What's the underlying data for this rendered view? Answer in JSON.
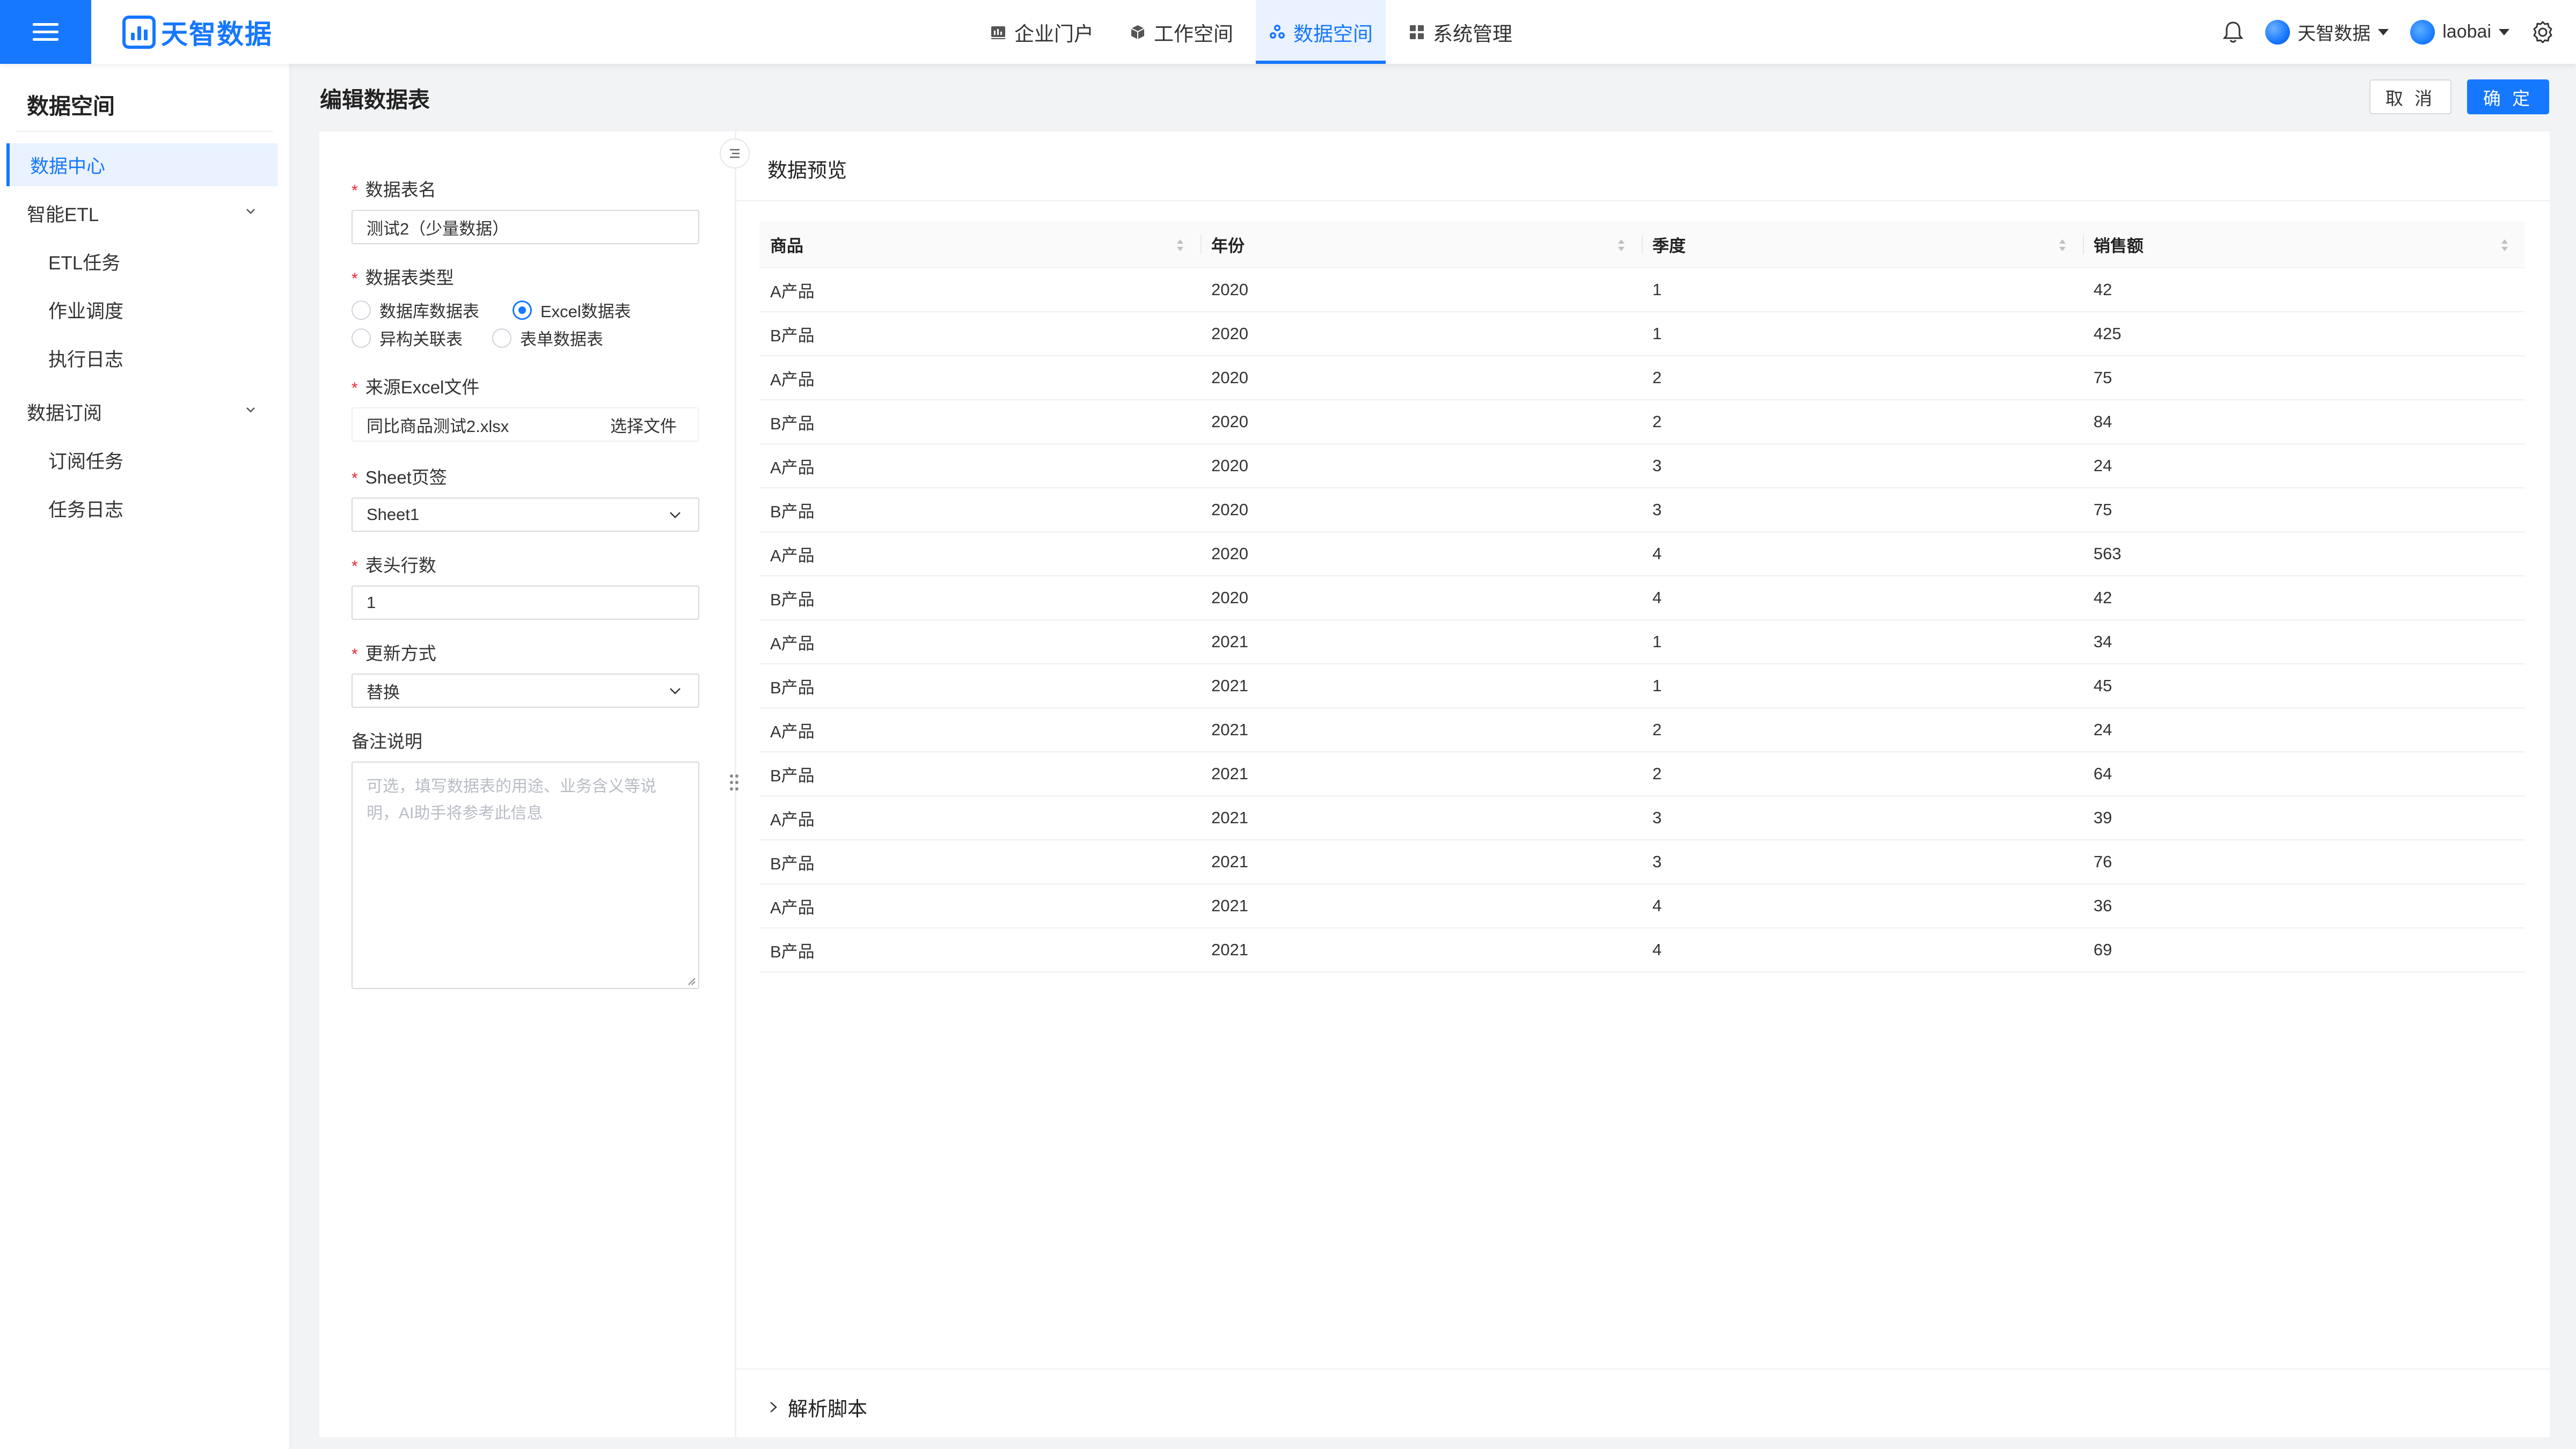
{
  "app": {
    "logo_text": "天智数据",
    "accent_color": "#1677ff"
  },
  "nav": {
    "items": [
      {
        "label": "企业门户",
        "icon": "dashboard-icon",
        "active": false
      },
      {
        "label": "工作空间",
        "icon": "cube-icon",
        "active": false
      },
      {
        "label": "数据空间",
        "icon": "data-space-icon",
        "active": true
      },
      {
        "label": "系统管理",
        "icon": "grid-icon",
        "active": false
      }
    ]
  },
  "topright": {
    "org_name": "天智数据",
    "user_name": "laobai"
  },
  "sidebar": {
    "title": "数据空间",
    "items": [
      {
        "label": "数据中心",
        "active": true
      },
      {
        "label": "智能ETL",
        "expandable": true
      },
      {
        "label": "ETL任务",
        "sub": true
      },
      {
        "label": "作业调度",
        "sub": true
      },
      {
        "label": "执行日志",
        "sub": true
      },
      {
        "label": "数据订阅",
        "expandable": true
      },
      {
        "label": "订阅任务",
        "sub": true
      },
      {
        "label": "任务日志",
        "sub": true
      }
    ]
  },
  "page": {
    "title": "编辑数据表",
    "cancel_label": "取 消",
    "ok_label": "确 定"
  },
  "form": {
    "name_label": "数据表名",
    "name_value": "测试2（少量数据）",
    "type_label": "数据表类型",
    "type_options": [
      "数据库数据表",
      "Excel数据表",
      "异构关联表",
      "表单数据表"
    ],
    "type_selected": "Excel数据表",
    "source_label": "来源Excel文件",
    "source_value": "同比商品测试2.xlsx",
    "choose_file_label": "选择文件",
    "sheet_label": "Sheet页签",
    "sheet_value": "Sheet1",
    "header_rows_label": "表头行数",
    "header_rows_value": "1",
    "update_label": "更新方式",
    "update_value": "替换",
    "remark_label": "备注说明",
    "remark_placeholder": "可选，填写数据表的用途、业务含义等说明，AI助手将参考此信息"
  },
  "preview": {
    "title": "数据预览",
    "columns": [
      "商品",
      "年份",
      "季度",
      "销售额"
    ],
    "rows": [
      [
        "A产品",
        "2020",
        "1",
        "42"
      ],
      [
        "B产品",
        "2020",
        "1",
        "425"
      ],
      [
        "A产品",
        "2020",
        "2",
        "75"
      ],
      [
        "B产品",
        "2020",
        "2",
        "84"
      ],
      [
        "A产品",
        "2020",
        "3",
        "24"
      ],
      [
        "B产品",
        "2020",
        "3",
        "75"
      ],
      [
        "A产品",
        "2020",
        "4",
        "563"
      ],
      [
        "B产品",
        "2020",
        "4",
        "42"
      ],
      [
        "A产品",
        "2021",
        "1",
        "34"
      ],
      [
        "B产品",
        "2021",
        "1",
        "45"
      ],
      [
        "A产品",
        "2021",
        "2",
        "24"
      ],
      [
        "B产品",
        "2021",
        "2",
        "64"
      ],
      [
        "A产品",
        "2021",
        "3",
        "39"
      ],
      [
        "B产品",
        "2021",
        "3",
        "76"
      ],
      [
        "A产品",
        "2021",
        "4",
        "36"
      ],
      [
        "B产品",
        "2021",
        "4",
        "69"
      ]
    ],
    "script_label": "解析脚本"
  }
}
